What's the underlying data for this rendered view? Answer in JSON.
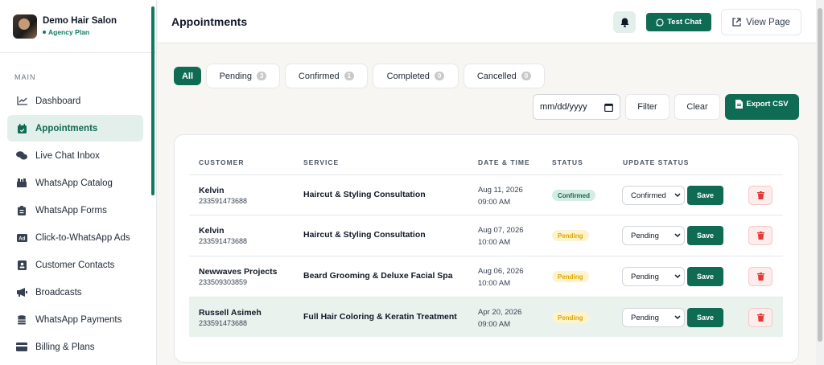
{
  "sidebar": {
    "brand_name": "Demo Hair Salon",
    "brand_plan": "Agency Plan",
    "section_label": "MAIN",
    "items": [
      {
        "label": "Dashboard",
        "icon": "chart-icon"
      },
      {
        "label": "Appointments",
        "icon": "calendar-icon",
        "active": true
      },
      {
        "label": "Live Chat Inbox",
        "icon": "comments-icon"
      },
      {
        "label": "WhatsApp Catalog",
        "icon": "store-icon"
      },
      {
        "label": "WhatsApp Forms",
        "icon": "clipboard-icon"
      },
      {
        "label": "Click-to-WhatsApp Ads",
        "icon": "ad-icon"
      },
      {
        "label": "Customer Contacts",
        "icon": "contact-card-icon"
      },
      {
        "label": "Broadcasts",
        "icon": "megaphone-icon"
      },
      {
        "label": "WhatsApp Payments",
        "icon": "coins-icon"
      },
      {
        "label": "Billing & Plans",
        "icon": "credit-card-icon"
      }
    ]
  },
  "header": {
    "title": "Appointments",
    "test_chat_label": "Test Chat",
    "view_page_label": "View Page"
  },
  "tabs": [
    {
      "label": "All",
      "count": null,
      "active": true
    },
    {
      "label": "Pending",
      "count": "3"
    },
    {
      "label": "Confirmed",
      "count": "1"
    },
    {
      "label": "Completed",
      "count": "0"
    },
    {
      "label": "Cancelled",
      "count": "0"
    }
  ],
  "filters": {
    "date_placeholder": "mm/dd/yyyy",
    "filter_label": "Filter",
    "clear_label": "Clear",
    "export_label": "Export CSV"
  },
  "table": {
    "headers": {
      "customer": "CUSTOMER",
      "service": "SERVICE",
      "datetime": "DATE & TIME",
      "status": "STATUS",
      "update": "UPDATE STATUS"
    },
    "save_label": "Save",
    "rows": [
      {
        "name": "Kelvin",
        "phone": "233591473688",
        "service": "Haircut & Styling Consultation",
        "date": "Aug 11, 2026",
        "time": "09:00 AM",
        "status": "Confirmed",
        "selected": "Confirmed"
      },
      {
        "name": "Kelvin",
        "phone": "233591473688",
        "service": "Haircut & Styling Consultation",
        "date": "Aug 07, 2026",
        "time": "10:00 AM",
        "status": "Pending",
        "selected": "Pending"
      },
      {
        "name": "Newwaves Projects",
        "phone": "233509303859",
        "service": "Beard Grooming & Deluxe Facial Spa",
        "date": "Aug 06, 2026",
        "time": "10:00 AM",
        "status": "Pending",
        "selected": "Pending"
      },
      {
        "name": "Russell Asimeh",
        "phone": "233591473688",
        "service": "Full Hair Coloring & Keratin Treatment",
        "date": "Apr 20, 2026",
        "time": "09:00 AM",
        "status": "Pending",
        "selected": "Pending"
      }
    ]
  },
  "colors": {
    "primary": "#0f6b53",
    "active_bg": "#e3efea",
    "pending_text": "#d9a900",
    "danger": "#e53935"
  }
}
